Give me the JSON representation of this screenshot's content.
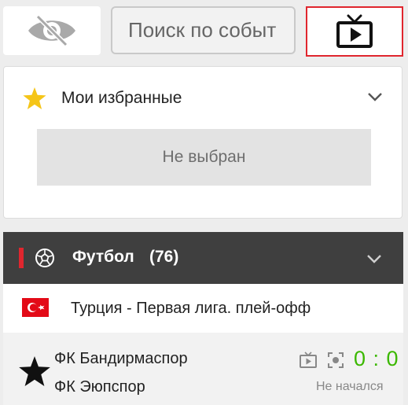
{
  "top_bar": {
    "visibility_toggle_icon": "eye-off-icon",
    "search": {
      "placeholder": "Поиск по событ",
      "value": ""
    },
    "tv_icon": "tv-icon",
    "active_border_color": "#e0262e"
  },
  "favorites": {
    "star_icon": "star-icon",
    "title": "Мои избранные",
    "empty_label": "Не выбран",
    "chevron_icon": "chevron-down-icon",
    "star_color": "#f5c518"
  },
  "sport": {
    "icon": "soccer-ball-icon",
    "name": "Футбол",
    "count": "(76)",
    "accent_color": "#e0262e",
    "chevron_icon": "chevron-down-icon"
  },
  "league": {
    "flag_icon": "turkey-flag-icon",
    "name": "Турция - Первая лига. плей-офф"
  },
  "match": {
    "favorite_icon": "star-icon",
    "team1": "ФК Бандирмаспор",
    "team2": "ФК Эюпспор",
    "tv_icon": "tv-icon",
    "fullscreen_icon": "target-icon",
    "score": "0 : 0",
    "status": "Не начался",
    "score_color": "#3bb800"
  }
}
